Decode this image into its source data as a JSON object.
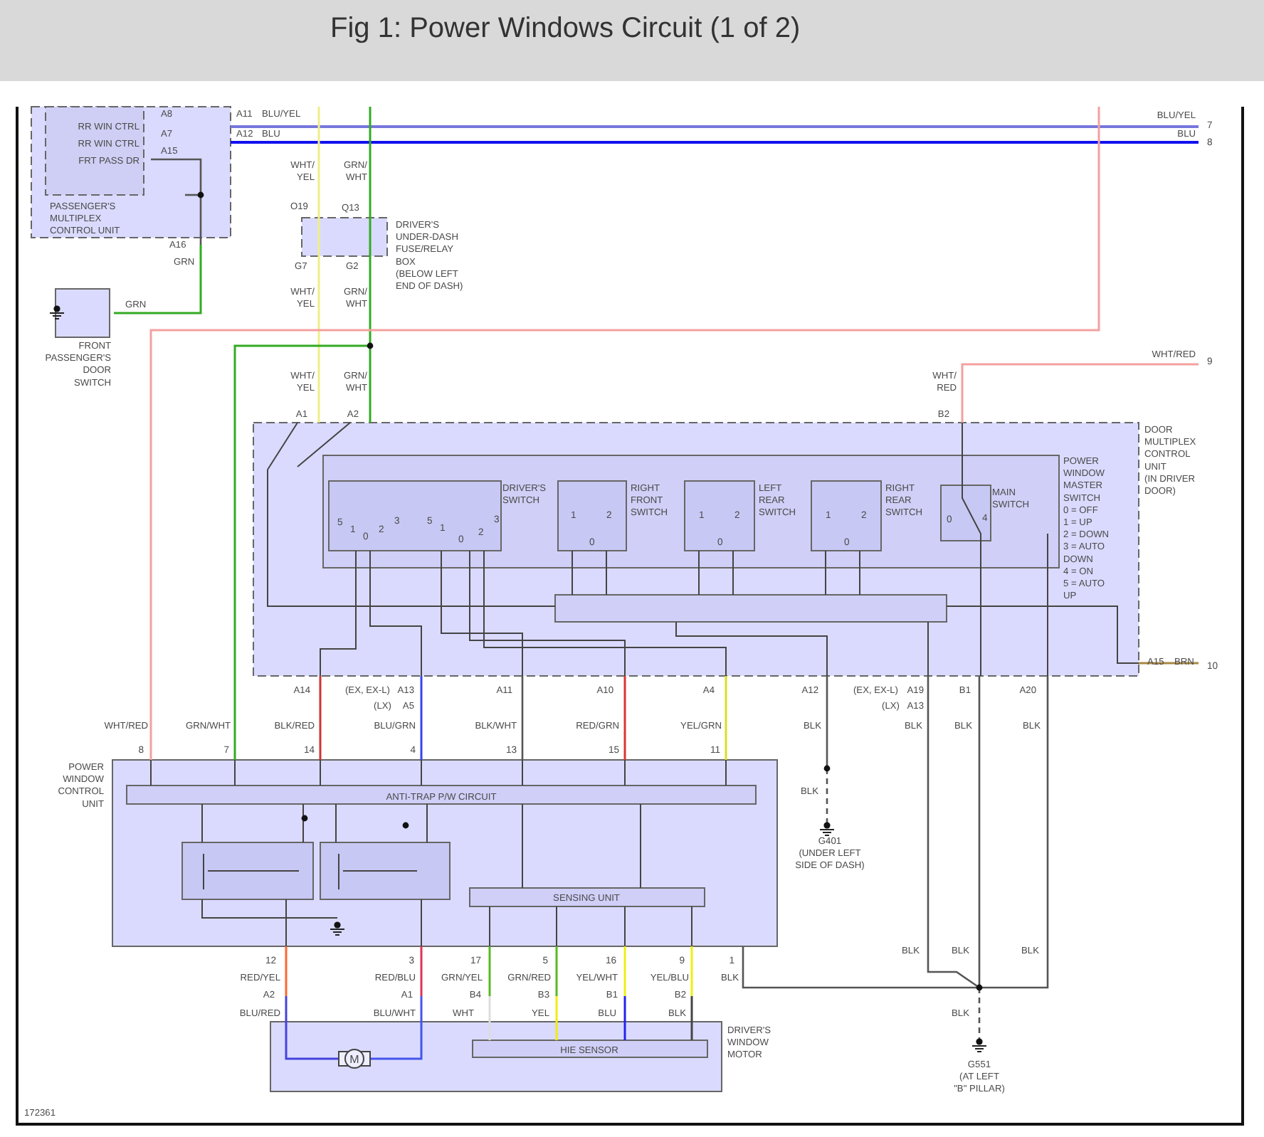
{
  "page": {
    "title": "Fig 1: Power Windows Circuit (1 of 2)"
  },
  "diagram": {
    "labels": [
      {
        "kind": "connector",
        "text": "A8"
      },
      {
        "kind": "connector",
        "text": "A11"
      },
      {
        "kind": "wire",
        "text": "BLU/YEL"
      },
      {
        "kind": "wire",
        "text": "BLU/YEL"
      },
      {
        "kind": "pin",
        "text": "7"
      },
      {
        "kind": "box",
        "text": "RR WIN CTRL"
      },
      {
        "kind": "connector",
        "text": "A7"
      },
      {
        "kind": "connector",
        "text": "A12"
      },
      {
        "kind": "wire",
        "text": "BLU"
      },
      {
        "kind": "wire",
        "text": "BLU"
      },
      {
        "kind": "pin",
        "text": "8"
      },
      {
        "kind": "box",
        "text": "RR WIN CTRL"
      },
      {
        "kind": "connector",
        "text": "A15"
      },
      {
        "kind": "box",
        "text": "FRT PASS DR"
      },
      {
        "kind": "wire",
        "lines": [
          "WHT/",
          "YEL"
        ]
      },
      {
        "kind": "wire",
        "lines": [
          "GRN/",
          "WHT"
        ]
      },
      {
        "kind": "component",
        "lines": [
          "PASSENGER'S",
          "MULTIPLEX",
          "CONTROL UNIT"
        ]
      },
      {
        "kind": "connector",
        "text": "O19"
      },
      {
        "kind": "connector",
        "text": "Q13"
      },
      {
        "kind": "component",
        "lines": [
          "DRIVER'S",
          "UNDER-DASH",
          "FUSE/RELAY",
          "BOX",
          "(BELOW LEFT",
          "END OF DASH)"
        ]
      },
      {
        "kind": "connector",
        "text": "A16"
      },
      {
        "kind": "connector",
        "text": "G7"
      },
      {
        "kind": "connector",
        "text": "G2"
      },
      {
        "kind": "wire",
        "text": "GRN"
      },
      {
        "kind": "wire",
        "text": "GRN"
      },
      {
        "kind": "wire",
        "lines": [
          "WHT/",
          "YEL"
        ]
      },
      {
        "kind": "wire",
        "lines": [
          "GRN/",
          "WHT"
        ]
      },
      {
        "kind": "component",
        "lines": [
          "FRONT",
          "PASSENGER'S",
          "DOOR",
          "SWITCH"
        ]
      },
      {
        "kind": "wire",
        "text": "WHT/RED"
      },
      {
        "kind": "pin",
        "text": "9"
      },
      {
        "kind": "wire",
        "lines": [
          "WHT/",
          "YEL"
        ]
      },
      {
        "kind": "wire",
        "lines": [
          "GRN/",
          "WHT"
        ]
      },
      {
        "kind": "wire",
        "lines": [
          "WHT/",
          "RED"
        ]
      },
      {
        "kind": "connector",
        "text": "A1"
      },
      {
        "kind": "connector",
        "text": "A2"
      },
      {
        "kind": "connector",
        "text": "B2"
      },
      {
        "kind": "component",
        "lines": [
          "DOOR",
          "MULTIPLEX",
          "CONTROL",
          "UNIT",
          "(IN DRIVER",
          "DOOR)"
        ]
      },
      {
        "kind": "legend",
        "lines": [
          "POWER",
          "WINDOW",
          "MASTER",
          "SWITCH",
          "0 = OFF",
          "1 = UP",
          "2 = DOWN",
          "3 = AUTO",
          "DOWN",
          "4 = ON",
          "5 = AUTO",
          "UP"
        ]
      },
      {
        "kind": "box",
        "lines": [
          "DRIVER'S",
          "SWITCH"
        ]
      },
      {
        "kind": "box",
        "lines": [
          "RIGHT",
          "FRONT",
          "SWITCH"
        ]
      },
      {
        "kind": "box",
        "lines": [
          "LEFT",
          "REAR",
          "SWITCH"
        ]
      },
      {
        "kind": "box",
        "lines": [
          "RIGHT",
          "REAR",
          "SWITCH"
        ]
      },
      {
        "kind": "box",
        "lines": [
          "MAIN",
          "SWITCH"
        ]
      },
      {
        "kind": "pin",
        "text": "5"
      },
      {
        "kind": "pin",
        "text": "1"
      },
      {
        "kind": "pin",
        "text": "0"
      },
      {
        "kind": "pin",
        "text": "2"
      },
      {
        "kind": "pin",
        "text": "3"
      },
      {
        "kind": "pin",
        "text": "5"
      },
      {
        "kind": "pin",
        "text": "1"
      },
      {
        "kind": "pin",
        "text": "0"
      },
      {
        "kind": "pin",
        "text": "2"
      },
      {
        "kind": "pin",
        "text": "3"
      },
      {
        "kind": "pin",
        "text": "1"
      },
      {
        "kind": "pin",
        "text": "2"
      },
      {
        "kind": "pin",
        "text": "0"
      },
      {
        "kind": "pin",
        "text": "1"
      },
      {
        "kind": "pin",
        "text": "2"
      },
      {
        "kind": "pin",
        "text": "0"
      },
      {
        "kind": "pin",
        "text": "1"
      },
      {
        "kind": "pin",
        "text": "2"
      },
      {
        "kind": "pin",
        "text": "0"
      },
      {
        "kind": "pin",
        "text": "0"
      },
      {
        "kind": "pin",
        "text": "4"
      },
      {
        "kind": "connector",
        "text": "A15"
      },
      {
        "kind": "wire",
        "text": "BRN"
      },
      {
        "kind": "pin",
        "text": "10"
      },
      {
        "kind": "connector",
        "text": "A14"
      },
      {
        "kind": "note",
        "text": "(EX, EX-L)"
      },
      {
        "kind": "connector",
        "text": "A13"
      },
      {
        "kind": "note",
        "text": "(LX)"
      },
      {
        "kind": "connector",
        "text": "A5"
      },
      {
        "kind": "connector",
        "text": "A11"
      },
      {
        "kind": "connector",
        "text": "A10"
      },
      {
        "kind": "connector",
        "text": "A4"
      },
      {
        "kind": "connector",
        "text": "A12"
      },
      {
        "kind": "note",
        "text": "(EX, EX-L)"
      },
      {
        "kind": "connector",
        "text": "A19"
      },
      {
        "kind": "note",
        "text": "(LX)"
      },
      {
        "kind": "connector",
        "text": "A13"
      },
      {
        "kind": "connector",
        "text": "B1"
      },
      {
        "kind": "connector",
        "text": "A20"
      },
      {
        "kind": "wire",
        "text": "WHT/RED"
      },
      {
        "kind": "wire",
        "text": "GRN/WHT"
      },
      {
        "kind": "wire",
        "text": "BLK/RED"
      },
      {
        "kind": "wire",
        "text": "BLU/GRN"
      },
      {
        "kind": "wire",
        "text": "BLK/WHT"
      },
      {
        "kind": "wire",
        "text": "RED/GRN"
      },
      {
        "kind": "wire",
        "text": "YEL/GRN"
      },
      {
        "kind": "wire",
        "text": "BLK"
      },
      {
        "kind": "wire",
        "text": "BLK"
      },
      {
        "kind": "wire",
        "text": "BLK"
      },
      {
        "kind": "wire",
        "text": "BLK"
      },
      {
        "kind": "pin",
        "text": "8"
      },
      {
        "kind": "pin",
        "text": "7"
      },
      {
        "kind": "pin",
        "text": "14"
      },
      {
        "kind": "pin",
        "text": "4"
      },
      {
        "kind": "pin",
        "text": "13"
      },
      {
        "kind": "pin",
        "text": "15"
      },
      {
        "kind": "pin",
        "text": "11"
      },
      {
        "kind": "component",
        "lines": [
          "POWER",
          "WINDOW",
          "CONTROL",
          "UNIT"
        ]
      },
      {
        "kind": "box",
        "text": "ANTI-TRAP P/W CIRCUIT"
      },
      {
        "kind": "wire",
        "text": "BLK"
      },
      {
        "kind": "ground",
        "lines": [
          "G401",
          "(UNDER LEFT",
          "SIDE OF DASH)"
        ]
      },
      {
        "kind": "box",
        "text": "SENSING UNIT"
      },
      {
        "kind": "wire",
        "text": "BLK"
      },
      {
        "kind": "wire",
        "text": "BLK"
      },
      {
        "kind": "wire",
        "text": "BLK"
      },
      {
        "kind": "pin",
        "text": "12"
      },
      {
        "kind": "pin",
        "text": "3"
      },
      {
        "kind": "pin",
        "text": "17"
      },
      {
        "kind": "pin",
        "text": "5"
      },
      {
        "kind": "pin",
        "text": "16"
      },
      {
        "kind": "pin",
        "text": "9"
      },
      {
        "kind": "pin",
        "text": "1"
      },
      {
        "kind": "wire",
        "text": "RED/YEL"
      },
      {
        "kind": "wire",
        "text": "RED/BLU"
      },
      {
        "kind": "wire",
        "text": "GRN/YEL"
      },
      {
        "kind": "wire",
        "text": "GRN/RED"
      },
      {
        "kind": "wire",
        "text": "YEL/WHT"
      },
      {
        "kind": "wire",
        "text": "YEL/BLU"
      },
      {
        "kind": "wire",
        "text": "BLK"
      },
      {
        "kind": "connector",
        "text": "A2"
      },
      {
        "kind": "connector",
        "text": "A1"
      },
      {
        "kind": "connector",
        "text": "B4"
      },
      {
        "kind": "connector",
        "text": "B3"
      },
      {
        "kind": "connector",
        "text": "B1"
      },
      {
        "kind": "connector",
        "text": "B2"
      },
      {
        "kind": "wire",
        "text": "BLU/RED"
      },
      {
        "kind": "wire",
        "text": "BLU/WHT"
      },
      {
        "kind": "wire",
        "text": "WHT"
      },
      {
        "kind": "wire",
        "text": "YEL"
      },
      {
        "kind": "wire",
        "text": "BLU"
      },
      {
        "kind": "wire",
        "text": "BLK"
      },
      {
        "kind": "wire",
        "text": "BLK"
      },
      {
        "kind": "box",
        "text": "HIE SENSOR"
      },
      {
        "kind": "component",
        "lines": [
          "DRIVER'S",
          "WINDOW",
          "MOTOR"
        ]
      },
      {
        "kind": "symbol",
        "text": "M"
      },
      {
        "kind": "ground",
        "lines": [
          "G551",
          "(AT LEFT",
          "\"B\" PILLAR)"
        ]
      },
      {
        "kind": "note",
        "text": "172361"
      }
    ]
  }
}
